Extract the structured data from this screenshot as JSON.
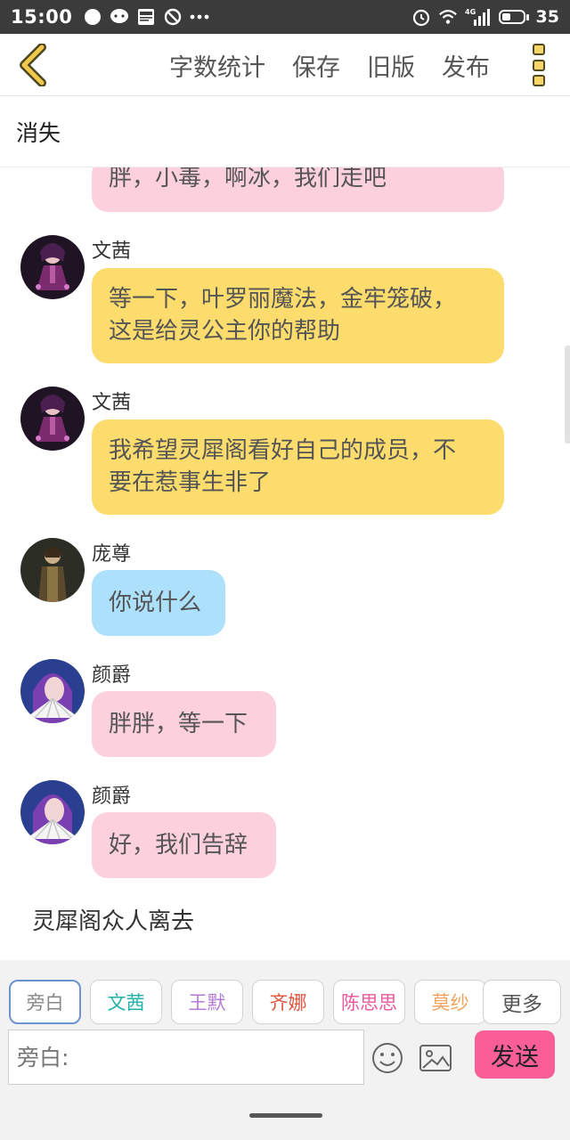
{
  "status_bar": {
    "time": "15:00",
    "battery": "35",
    "network": "4G",
    "left_icons": [
      "bubble-icon",
      "chat-icon",
      "news-icon",
      "dnd-icon",
      "more-dots-icon"
    ],
    "right_icons": [
      "alarm-icon",
      "wifi-icon",
      "signal-icon",
      "battery-icon"
    ]
  },
  "toolbar": {
    "back_icon": "chevron-left-icon",
    "actions": [
      "字数统计",
      "保存",
      "旧版",
      "发布"
    ],
    "menu_icon": "vertical-menu-icon"
  },
  "page_title": "消失",
  "chat": {
    "messages": [
      {
        "sender": "",
        "text_lines": [
          "胖，小毒，啊冰，我们走吧"
        ],
        "color": "pink"
      },
      {
        "sender": "文茜",
        "text_lines": [
          "等一下，叶罗丽魔法，金牢笼破，",
          "这是给灵公主你的帮助"
        ],
        "color": "yellow"
      },
      {
        "sender": "文茜",
        "text_lines": [
          "我希望灵犀阁看好自己的成员，不",
          "要在惹事生非了"
        ],
        "color": "yellow"
      },
      {
        "sender": "庞尊",
        "text_lines": [
          "你说什么"
        ],
        "color": "blue"
      },
      {
        "sender": "颜爵",
        "text_lines": [
          "胖胖，等一下"
        ],
        "color": "pink"
      },
      {
        "sender": "颜爵",
        "text_lines": [
          "好，我们告辞"
        ],
        "color": "pink"
      }
    ],
    "narration": "灵犀阁众人离去"
  },
  "roles": [
    {
      "label": "旁白",
      "color": "#888888",
      "active": true
    },
    {
      "label": "文茜",
      "color": "#20b2aa",
      "active": false
    },
    {
      "label": "王默",
      "color": "#b57ad6",
      "active": false
    },
    {
      "label": "齐娜",
      "color": "#e0533a",
      "active": false
    },
    {
      "label": "陈思思",
      "color": "#ea5a9c",
      "active": false
    },
    {
      "label": "莫纱",
      "color": "#f3a35b",
      "active": false
    }
  ],
  "more_roles": "更多",
  "input": {
    "placeholder": "旁白:",
    "value": ""
  },
  "send": "发送",
  "colors": {
    "pink_bubble": "#fcd0dc",
    "yellow_bubble": "#fbdc6d",
    "blue_bubble": "#ade0fa",
    "send_button": "#f95f96",
    "back_arrow": "#f2c94c"
  }
}
